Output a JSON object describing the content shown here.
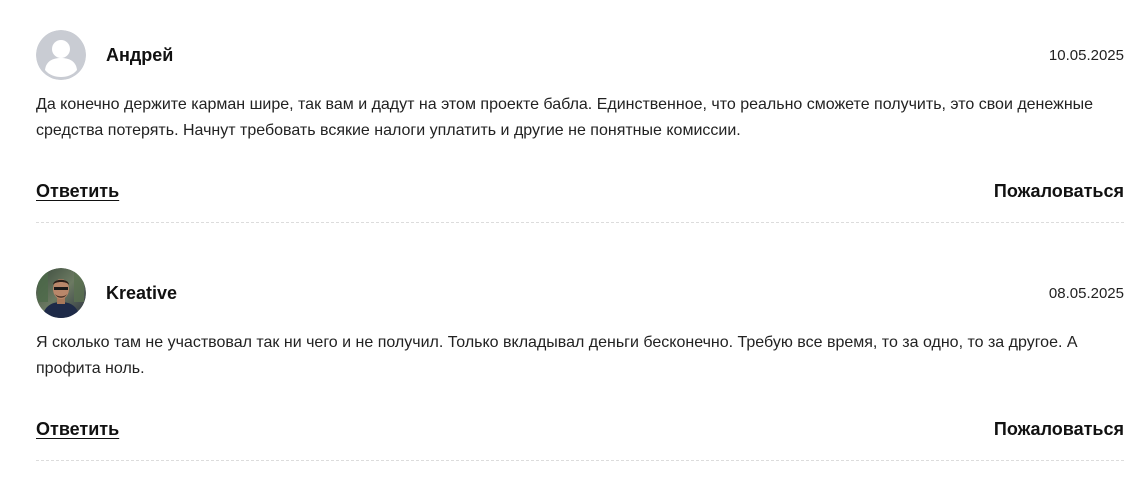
{
  "comments": [
    {
      "avatar_icon": "default-user-avatar-icon",
      "author": "Андрей",
      "date": "10.05.2025",
      "text": "Да конечно держите карман шире, так вам и дадут на этом проекте бабла. Единственное, что реально сможете получить, это свои денежные средства потерять. Начнут требовать всякие налоги уплатить и другие не понятные комиссии.",
      "reply_label": "Ответить",
      "report_label": "Пожаловаться"
    },
    {
      "avatar_icon": "user-photo-avatar",
      "author": "Kreative",
      "date": "08.05.2025",
      "text": "Я сколько там не участвовал так ни чего и не получил. Только вкладывал деньги бесконечно. Требую все время, то за одно, то за другое. А профита ноль.",
      "reply_label": "Ответить",
      "report_label": "Пожаловаться"
    }
  ],
  "colors": {
    "avatar_placeholder_bg": "#c9ccd3",
    "avatar_placeholder_fg": "#ffffff",
    "divider": "#dcdcdc",
    "text": "#222222"
  }
}
